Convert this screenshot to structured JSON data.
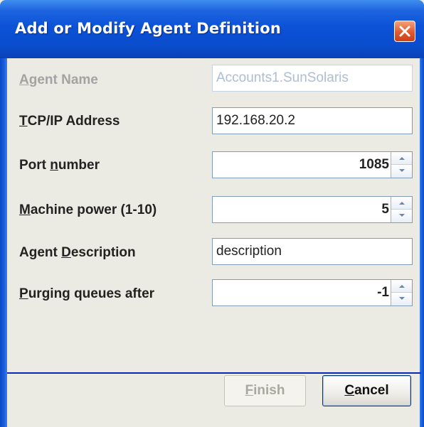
{
  "dialog": {
    "title": "Add or Modify Agent Definition"
  },
  "fields": {
    "agent_name": {
      "label_pre": "",
      "label_key": "A",
      "label_post": "gent Name",
      "value": "Accounts1.SunSolaris"
    },
    "tcpip": {
      "label_pre": "",
      "label_key": "T",
      "label_post": "CP/IP Address",
      "value": "192.168.20.2"
    },
    "port": {
      "label_pre": "Port ",
      "label_key": "n",
      "label_post": "umber",
      "value": "1085"
    },
    "machine_power": {
      "label_pre": "",
      "label_key": "M",
      "label_post": "achine power (1-10)",
      "value": "5"
    },
    "description": {
      "label_pre": "Agent ",
      "label_key": "D",
      "label_post": "escription",
      "value": "description"
    },
    "purging": {
      "label_pre": "",
      "label_key": "P",
      "label_post": "urging queues after",
      "value": "-1"
    }
  },
  "buttons": {
    "finish": {
      "label_key": "F",
      "label_post": "inish"
    },
    "cancel": {
      "label_key": "C",
      "label_post": "ancel"
    }
  },
  "colors": {
    "title_bar": "#0a4ccc",
    "close_button": "#e2592d",
    "separator": "#0a28b4",
    "disabled_text": "#a3a3a3"
  }
}
